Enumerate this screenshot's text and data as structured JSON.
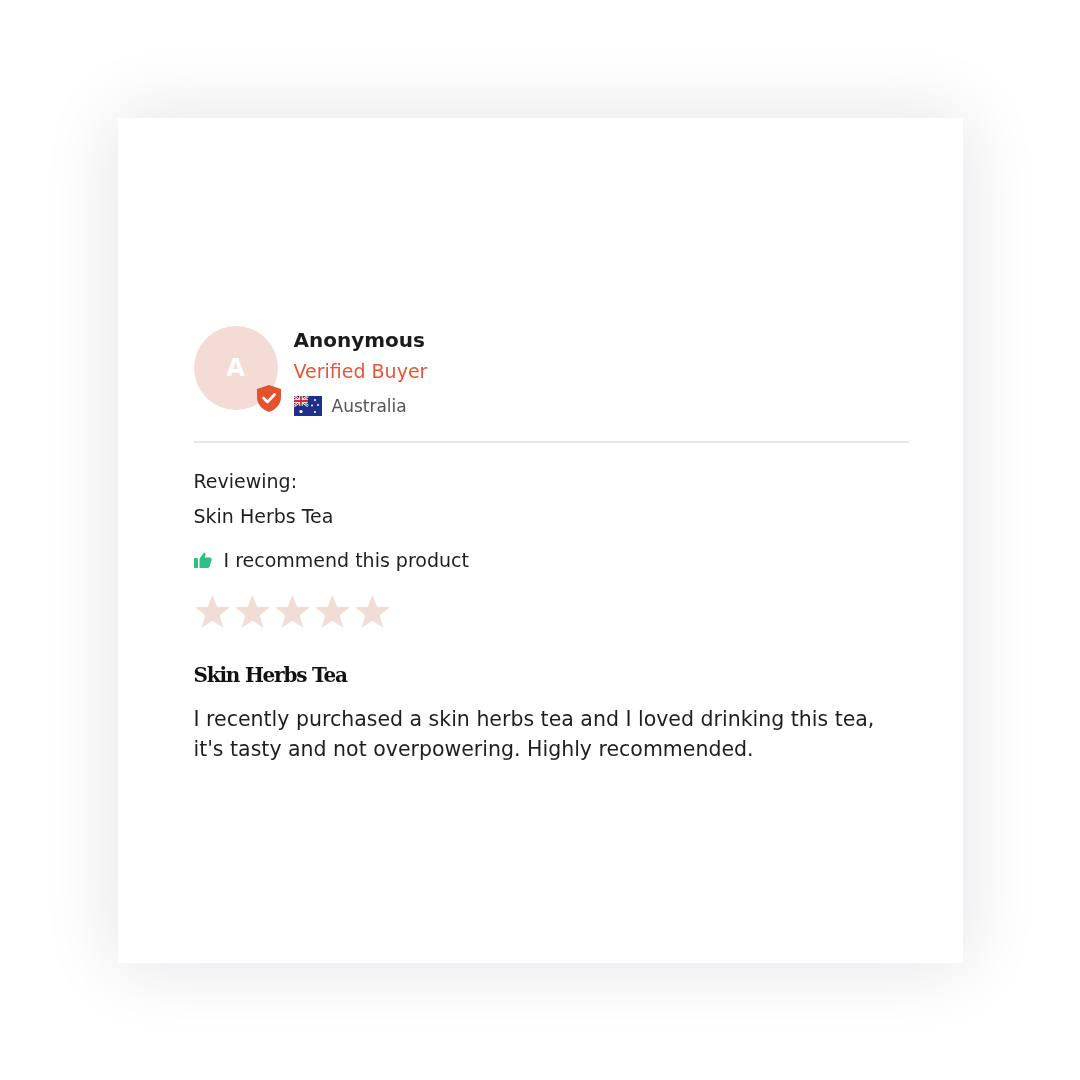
{
  "reviewer": {
    "avatar_initial": "A",
    "verified": true,
    "name": "Anonymous",
    "badge": "Verified Buyer",
    "country": "Australia"
  },
  "reviewing": {
    "label": "Reviewing:",
    "product": "Skin Herbs Tea"
  },
  "recommendation": {
    "recommended": true,
    "text": "I recommend this product"
  },
  "rating": {
    "stars": 5
  },
  "review": {
    "title": "Skin Herbs Tea",
    "body": "I recently purchased a skin herbs tea and I loved drinking this tea, it's tasty and not overpowering. Highly recommended."
  }
}
